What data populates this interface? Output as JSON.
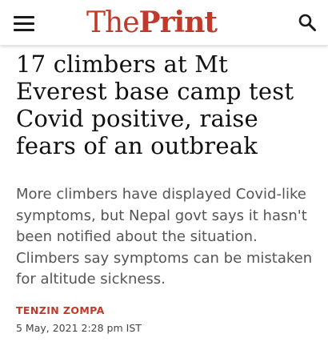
{
  "header": {
    "logo_the": "The",
    "logo_print": "Print",
    "menu_icon": "hamburger-menu-icon",
    "search_icon": "search-icon",
    "brand_color": "#c0392b"
  },
  "article": {
    "headline": "17 climbers at Mt Everest base camp test Covid positive, raise fears of an outbreak",
    "summary": "More climbers have displayed Covid-like symptoms, but Nepal govt says it hasn't been notified about the situation. Climbers say symptoms can be mistaken for altitude sickness.",
    "author": "TENZIN ZOMPA",
    "dateline": "5 May, 2021 2:28 pm IST"
  }
}
